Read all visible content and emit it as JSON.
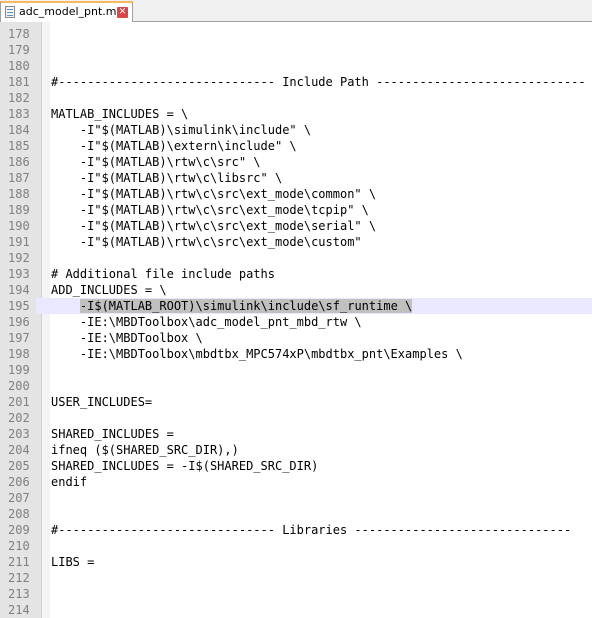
{
  "tab": {
    "label": "adc_model_pnt.mk",
    "icon": "file-icon",
    "close_icon": "close-icon"
  },
  "editor": {
    "current_line": 195,
    "highlight": {
      "line": 195,
      "before": "    ",
      "text": "-I$(MATLAB_ROOT)\\simulink\\include\\sf_runtime \\",
      "after": ""
    },
    "lines": [
      {
        "n": "178",
        "text": ""
      },
      {
        "n": "179",
        "text": ""
      },
      {
        "n": "180",
        "text": ""
      },
      {
        "n": "181",
        "text": "#------------------------------ Include Path -----------------------------"
      },
      {
        "n": "182",
        "text": ""
      },
      {
        "n": "183",
        "text": "MATLAB_INCLUDES = \\"
      },
      {
        "n": "184",
        "text": "    -I\"$(MATLAB)\\simulink\\include\" \\"
      },
      {
        "n": "185",
        "text": "    -I\"$(MATLAB)\\extern\\include\" \\"
      },
      {
        "n": "186",
        "text": "    -I\"$(MATLAB)\\rtw\\c\\src\" \\"
      },
      {
        "n": "187",
        "text": "    -I\"$(MATLAB)\\rtw\\c\\libsrc\" \\"
      },
      {
        "n": "188",
        "text": "    -I\"$(MATLAB)\\rtw\\c\\src\\ext_mode\\common\" \\"
      },
      {
        "n": "189",
        "text": "    -I\"$(MATLAB)\\rtw\\c\\src\\ext_mode\\tcpip\" \\"
      },
      {
        "n": "190",
        "text": "    -I\"$(MATLAB)\\rtw\\c\\src\\ext_mode\\serial\" \\"
      },
      {
        "n": "191",
        "text": "    -I\"$(MATLAB)\\rtw\\c\\src\\ext_mode\\custom\""
      },
      {
        "n": "192",
        "text": ""
      },
      {
        "n": "193",
        "text": "# Additional file include paths"
      },
      {
        "n": "194",
        "text": "ADD_INCLUDES = \\"
      },
      {
        "n": "195",
        "text": ""
      },
      {
        "n": "196",
        "text": "    -IE:\\MBDToolbox\\adc_model_pnt_mbd_rtw \\"
      },
      {
        "n": "197",
        "text": "    -IE:\\MBDToolbox \\"
      },
      {
        "n": "198",
        "text": "    -IE:\\MBDToolbox\\mbdtbx_MPC574xP\\mbdtbx_pnt\\Examples \\"
      },
      {
        "n": "199",
        "text": ""
      },
      {
        "n": "200",
        "text": ""
      },
      {
        "n": "201",
        "text": "USER_INCLUDES="
      },
      {
        "n": "202",
        "text": ""
      },
      {
        "n": "203",
        "text": "SHARED_INCLUDES ="
      },
      {
        "n": "204",
        "text": "ifneq ($(SHARED_SRC_DIR),)"
      },
      {
        "n": "205",
        "text": "SHARED_INCLUDES = -I$(SHARED_SRC_DIR)"
      },
      {
        "n": "206",
        "text": "endif"
      },
      {
        "n": "207",
        "text": ""
      },
      {
        "n": "208",
        "text": ""
      },
      {
        "n": "209",
        "text": "#------------------------------ Libraries ------------------------------"
      },
      {
        "n": "210",
        "text": ""
      },
      {
        "n": "211",
        "text": "LIBS ="
      },
      {
        "n": "212",
        "text": ""
      },
      {
        "n": "213",
        "text": ""
      },
      {
        "n": "214",
        "text": ""
      }
    ]
  }
}
